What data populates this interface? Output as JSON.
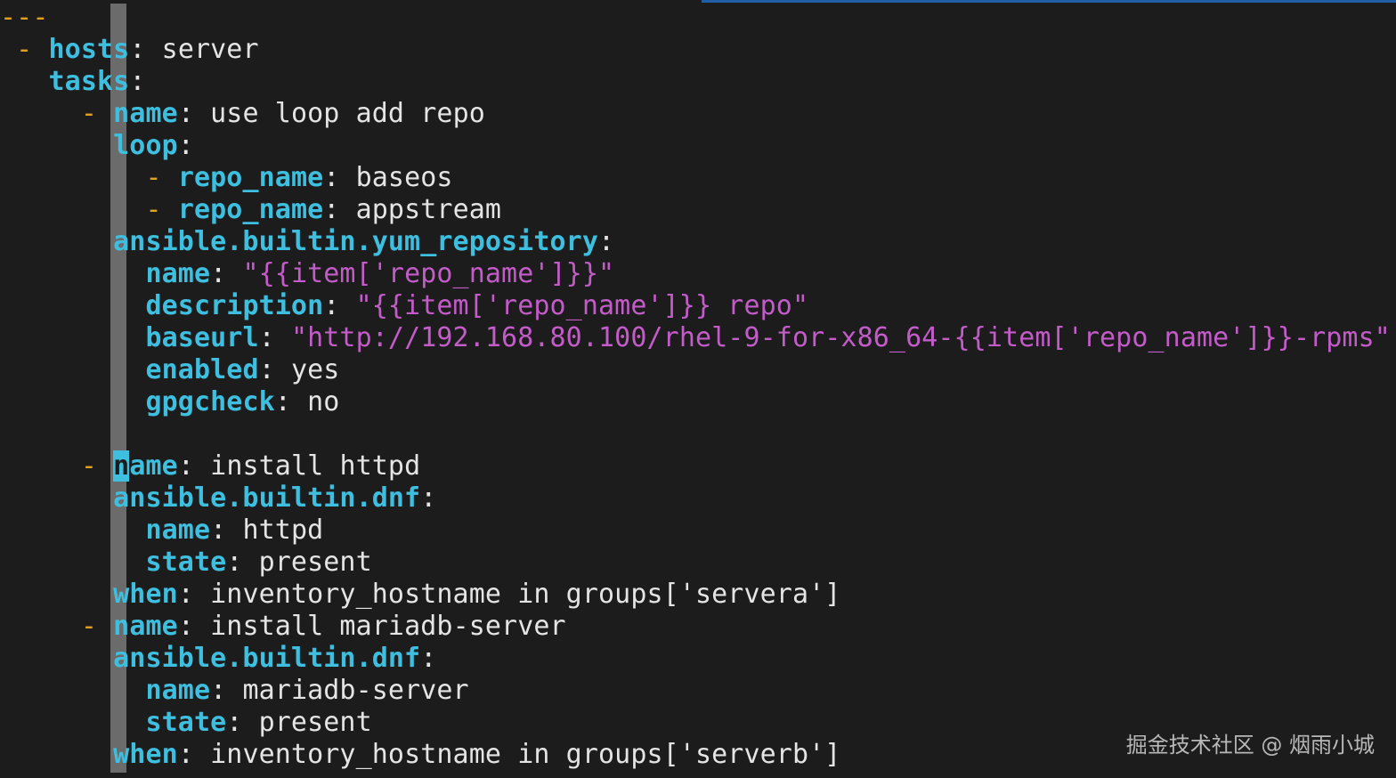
{
  "editor": {
    "lines": [
      [
        {
          "t": "---",
          "c": "indicator"
        }
      ],
      [
        {
          "t": " ",
          "c": "plain"
        },
        {
          "t": "-",
          "c": "indicator"
        },
        {
          "t": " ",
          "c": "plain"
        },
        {
          "t": "hosts",
          "c": "key"
        },
        {
          "t": ": ",
          "c": "colon"
        },
        {
          "t": "server",
          "c": "plain"
        }
      ],
      [
        {
          "t": "   ",
          "c": "plain"
        },
        {
          "t": "tasks",
          "c": "key"
        },
        {
          "t": ":",
          "c": "colon"
        }
      ],
      [
        {
          "t": "     ",
          "c": "plain"
        },
        {
          "t": "-",
          "c": "indicator"
        },
        {
          "t": " ",
          "c": "plain"
        },
        {
          "t": "name",
          "c": "key"
        },
        {
          "t": ": ",
          "c": "colon"
        },
        {
          "t": "use loop add repo",
          "c": "plain"
        }
      ],
      [
        {
          "t": "       ",
          "c": "plain"
        },
        {
          "t": "loop",
          "c": "key"
        },
        {
          "t": ":",
          "c": "colon"
        }
      ],
      [
        {
          "t": "         ",
          "c": "plain"
        },
        {
          "t": "-",
          "c": "indicator"
        },
        {
          "t": " ",
          "c": "plain"
        },
        {
          "t": "repo_name",
          "c": "key"
        },
        {
          "t": ": ",
          "c": "colon"
        },
        {
          "t": "baseos",
          "c": "plain"
        }
      ],
      [
        {
          "t": "         ",
          "c": "plain"
        },
        {
          "t": "-",
          "c": "indicator"
        },
        {
          "t": " ",
          "c": "plain"
        },
        {
          "t": "repo_name",
          "c": "key"
        },
        {
          "t": ": ",
          "c": "colon"
        },
        {
          "t": "appstream",
          "c": "plain"
        }
      ],
      [
        {
          "t": "       ",
          "c": "plain"
        },
        {
          "t": "ansible.builtin.yum_repository",
          "c": "key"
        },
        {
          "t": ":",
          "c": "colon"
        }
      ],
      [
        {
          "t": "         ",
          "c": "plain"
        },
        {
          "t": "name",
          "c": "key"
        },
        {
          "t": ": ",
          "c": "colon"
        },
        {
          "t": "\"{{item['repo_name']}}\"",
          "c": "string"
        }
      ],
      [
        {
          "t": "         ",
          "c": "plain"
        },
        {
          "t": "description",
          "c": "key"
        },
        {
          "t": ": ",
          "c": "colon"
        },
        {
          "t": "\"{{item['repo_name']}} repo\"",
          "c": "string"
        }
      ],
      [
        {
          "t": "         ",
          "c": "plain"
        },
        {
          "t": "baseurl",
          "c": "key"
        },
        {
          "t": ": ",
          "c": "colon"
        },
        {
          "t": "\"http://192.168.80.100/rhel-9-for-x86_64-{{item['repo_name']}}-rpms\"",
          "c": "string"
        }
      ],
      [
        {
          "t": "         ",
          "c": "plain"
        },
        {
          "t": "enabled",
          "c": "key"
        },
        {
          "t": ": ",
          "c": "colon"
        },
        {
          "t": "yes",
          "c": "plain"
        }
      ],
      [
        {
          "t": "         ",
          "c": "plain"
        },
        {
          "t": "gpgcheck",
          "c": "key"
        },
        {
          "t": ": ",
          "c": "colon"
        },
        {
          "t": "no",
          "c": "plain"
        }
      ],
      [],
      [
        {
          "t": "     ",
          "c": "plain"
        },
        {
          "t": "-",
          "c": "indicator"
        },
        {
          "t": " ",
          "c": "plain"
        },
        {
          "t": "n",
          "c": "cursor"
        },
        {
          "t": "ame",
          "c": "key"
        },
        {
          "t": ": ",
          "c": "colon"
        },
        {
          "t": "install httpd",
          "c": "plain"
        }
      ],
      [
        {
          "t": "       ",
          "c": "plain"
        },
        {
          "t": "ansible.builtin.dnf",
          "c": "key"
        },
        {
          "t": ":",
          "c": "colon"
        }
      ],
      [
        {
          "t": "         ",
          "c": "plain"
        },
        {
          "t": "name",
          "c": "key"
        },
        {
          "t": ": ",
          "c": "colon"
        },
        {
          "t": "httpd",
          "c": "plain"
        }
      ],
      [
        {
          "t": "         ",
          "c": "plain"
        },
        {
          "t": "state",
          "c": "key"
        },
        {
          "t": ": ",
          "c": "colon"
        },
        {
          "t": "present",
          "c": "plain"
        }
      ],
      [
        {
          "t": "       ",
          "c": "plain"
        },
        {
          "t": "when",
          "c": "key"
        },
        {
          "t": ": ",
          "c": "colon"
        },
        {
          "t": "inventory_hostname in groups['servera']",
          "c": "plain"
        }
      ],
      [
        {
          "t": "     ",
          "c": "plain"
        },
        {
          "t": "-",
          "c": "indicator"
        },
        {
          "t": " ",
          "c": "plain"
        },
        {
          "t": "name",
          "c": "key"
        },
        {
          "t": ": ",
          "c": "colon"
        },
        {
          "t": "install mariadb-server",
          "c": "plain"
        }
      ],
      [
        {
          "t": "       ",
          "c": "plain"
        },
        {
          "t": "ansible.builtin.dnf",
          "c": "key"
        },
        {
          "t": ":",
          "c": "colon"
        }
      ],
      [
        {
          "t": "         ",
          "c": "plain"
        },
        {
          "t": "name",
          "c": "key"
        },
        {
          "t": ": ",
          "c": "colon"
        },
        {
          "t": "mariadb-server",
          "c": "plain"
        }
      ],
      [
        {
          "t": "         ",
          "c": "plain"
        },
        {
          "t": "state",
          "c": "key"
        },
        {
          "t": ": ",
          "c": "colon"
        },
        {
          "t": "present",
          "c": "plain"
        }
      ],
      [
        {
          "t": "       ",
          "c": "plain"
        },
        {
          "t": "when",
          "c": "key"
        },
        {
          "t": ": ",
          "c": "colon"
        },
        {
          "t": "inventory_hostname in groups['serverb']",
          "c": "plain"
        }
      ]
    ]
  },
  "watermark": {
    "text": "掘金技术社区 @ 烟雨小城"
  },
  "colors": {
    "background": "#1c1c1c",
    "key": "#3fbfdf",
    "indicator": "#e0a020",
    "string": "#c35cc9",
    "text": "#e4e4e4",
    "cursor_column": "#6b6b6b"
  }
}
